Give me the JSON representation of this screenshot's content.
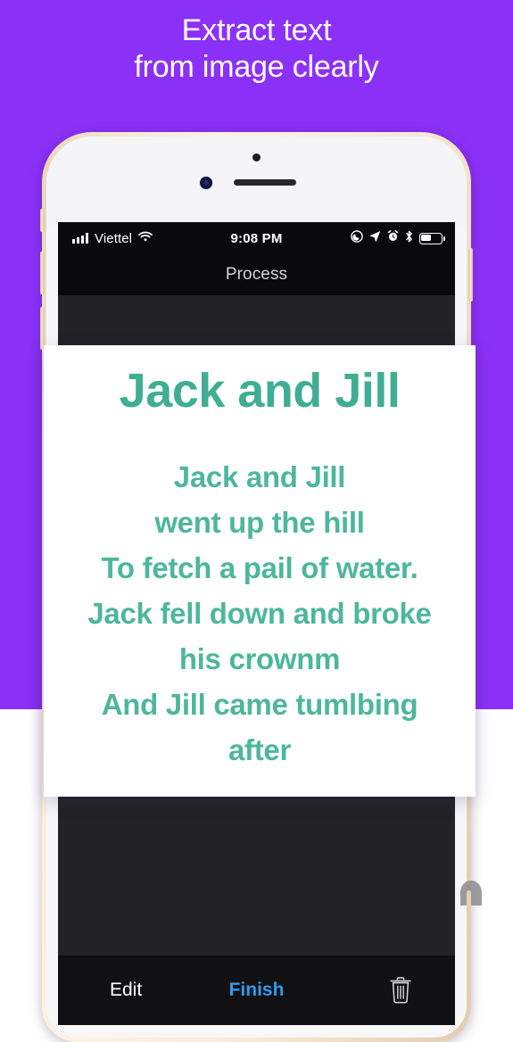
{
  "promo": {
    "headline": "Extract text\nfrom image clearly",
    "background_color": "#8B31F7",
    "headline_color": "#ffffff"
  },
  "device": {
    "frame_color": "#f5e6d2",
    "buttons": {
      "silent_switch": "silent-switch",
      "volume_up": "volume-up-button",
      "volume_down": "volume-down-button",
      "power": "power-button"
    },
    "sensors": {
      "proximity": "proximity-sensor",
      "camera": "front-camera",
      "earpiece": "earpiece-speaker"
    }
  },
  "statusbar": {
    "carrier": "Viettel",
    "signal_icon": "signal-bars-icon",
    "wifi_icon": "wifi-icon",
    "time": "9:08 PM",
    "icons": [
      "do-not-disturb-icon",
      "location-arrow-icon",
      "alarm-clock-icon",
      "bluetooth-icon"
    ],
    "battery_icon": "battery-icon",
    "battery_percent": 45
  },
  "navbar": {
    "title": "Process"
  },
  "extracted": {
    "title": "Jack and Jill",
    "body": "Jack and Jill\nwent up the hill\nTo fetch a pail of water.\nJack fell down and broke\nhis crownm\nAnd Jill came tumlbing\nafter",
    "text_color": "#3FAE92"
  },
  "toolbar": {
    "edit_label": "Edit",
    "finish_label": "Finish",
    "finish_color": "#2e9bf0",
    "delete_icon": "trash-icon"
  },
  "watermark": {
    "icon": "watermark-glyph"
  }
}
